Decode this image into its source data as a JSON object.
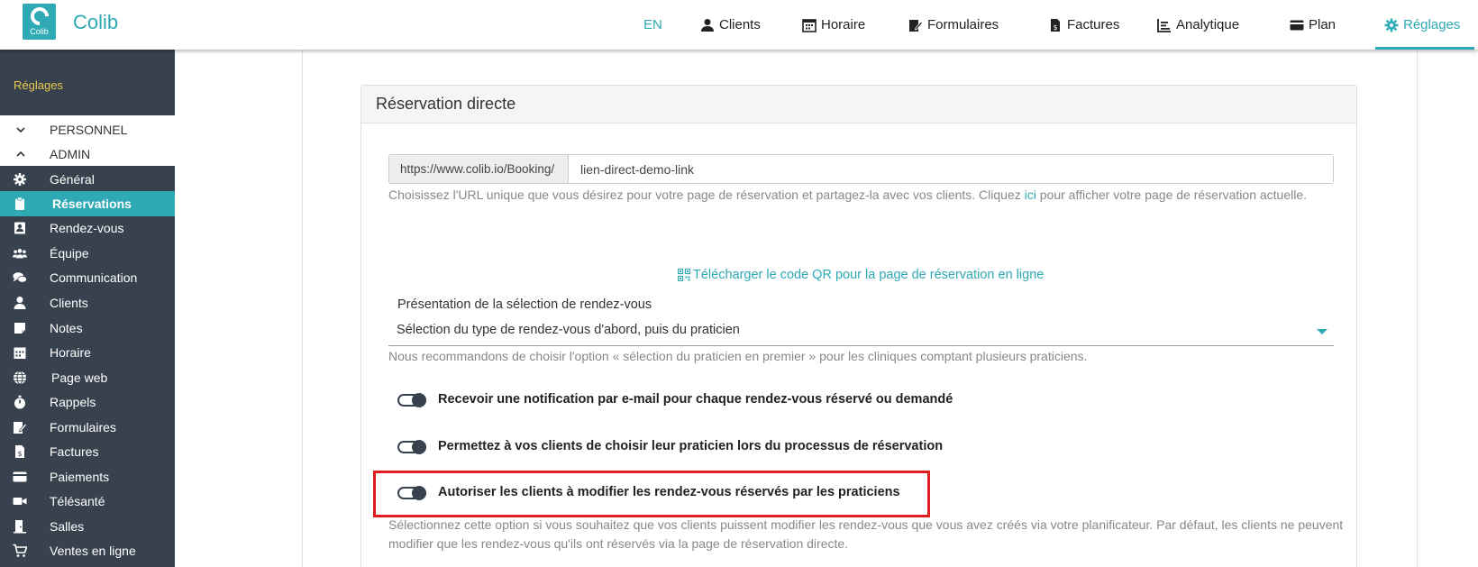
{
  "brand": {
    "name": "Colib",
    "logo_text": "Colib"
  },
  "nav": {
    "lang": "EN",
    "items": [
      {
        "label": "Clients",
        "icon": "user-icon"
      },
      {
        "label": "Horaire",
        "icon": "calendar-icon"
      },
      {
        "label": "Formulaires",
        "icon": "form-edit-icon"
      },
      {
        "label": "Factures",
        "icon": "invoice-icon"
      },
      {
        "label": "Analytique",
        "icon": "chart-icon"
      },
      {
        "label": "Plan",
        "icon": "credit-card-icon"
      },
      {
        "label": "Réglages",
        "icon": "gear-icon"
      }
    ],
    "active": "Réglages",
    "accent": "#2fa9b4"
  },
  "sidebar": {
    "title": "Réglages",
    "groups": [
      {
        "label": "PERSONNEL",
        "icon": "chevron-down-icon"
      },
      {
        "label": "ADMIN",
        "icon": "chevron-up-icon"
      }
    ],
    "items": [
      {
        "label": "Général",
        "icon": "gear-icon"
      },
      {
        "label": "Réservations",
        "icon": "clipboard-icon"
      },
      {
        "label": "Rendez-vous",
        "icon": "contact-card-icon"
      },
      {
        "label": "Équipe",
        "icon": "team-icon"
      },
      {
        "label": "Communication",
        "icon": "chat-icon"
      },
      {
        "label": "Clients",
        "icon": "user-icon"
      },
      {
        "label": "Notes",
        "icon": "note-icon"
      },
      {
        "label": "Horaire",
        "icon": "calendar-icon"
      },
      {
        "label": "Page web",
        "icon": "globe-icon"
      },
      {
        "label": "Rappels",
        "icon": "stopwatch-icon"
      },
      {
        "label": "Formulaires",
        "icon": "form-edit-icon"
      },
      {
        "label": "Factures",
        "icon": "invoice-icon"
      },
      {
        "label": "Paiements",
        "icon": "credit-card-icon"
      },
      {
        "label": "Télésanté",
        "icon": "video-icon"
      },
      {
        "label": "Salles",
        "icon": "door-icon"
      },
      {
        "label": "Ventes en ligne",
        "icon": "cart-icon"
      }
    ],
    "active": "Réservations"
  },
  "card": {
    "title": "Réservation directe",
    "url_prefix": "https://www.colib.io/Booking/",
    "url_value": "lien-direct-demo-link",
    "url_help_before": "Choisissez l'URL unique que vous désirez pour votre page de réservation et partagez-la avec vos clients. Cliquez ",
    "url_help_link": "ici",
    "url_help_after": " pour afficher votre page de réservation actuelle.",
    "qr_link": "Télécharger le code QR pour la page de réservation en ligne",
    "select_label": "Présentation de la sélection de rendez-vous",
    "select_value": "Sélection du type de rendez-vous d'abord, puis du praticien",
    "select_help": "Nous recommandons de choisir l'option « sélection du praticien en premier » pour les cliniques comptant plusieurs praticiens.",
    "toggles": [
      {
        "label": "Recevoir une notification par e-mail pour chaque rendez-vous réservé ou demandé",
        "on": true
      },
      {
        "label": "Permettez à vos clients de choisir leur praticien lors du processus de réservation",
        "on": true
      },
      {
        "label": "Autoriser les clients à modifier les rendez-vous réservés par les praticiens",
        "on": true
      }
    ],
    "last_help": "Sélectionnez cette option si vous souhaitez que vos clients puissent modifier les rendez-vous que vous avez créés via votre planificateur. Par défaut, les clients ne peuvent modifier que les rendez-vous qu'ils ont réservés via la page de réservation directe.",
    "highlight_color": "#e11b22"
  }
}
